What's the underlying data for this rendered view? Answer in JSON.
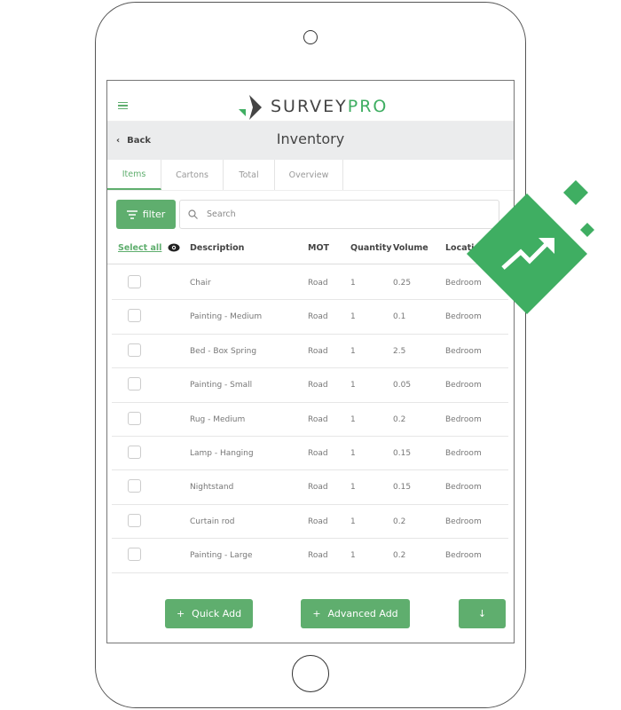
{
  "header": {
    "logo_left": "SURVEY",
    "logo_right": "PRO",
    "back_label": "Back",
    "title": "Inventory"
  },
  "tabs": [
    {
      "label": "Items",
      "active": true
    },
    {
      "label": "Cartons"
    },
    {
      "label": "Total"
    },
    {
      "label": "Overview"
    }
  ],
  "toolbar": {
    "filter_label": "filter",
    "search_placeholder": "Search"
  },
  "table": {
    "select_all": "Select all",
    "columns": [
      "Description",
      "MOT",
      "Quantity",
      "Volume",
      "Location"
    ],
    "rows": [
      [
        "Chair",
        "Road",
        "1",
        "0.25",
        "Bedroom"
      ],
      [
        "Painting - Medium",
        "Road",
        "1",
        "0.1",
        "Bedroom"
      ],
      [
        "Bed - Box Spring",
        "Road",
        "1",
        "2.5",
        "Bedroom"
      ],
      [
        "Painting - Small",
        "Road",
        "1",
        "0.05",
        "Bedroom"
      ],
      [
        "Rug - Medium",
        "Road",
        "1",
        "0.2",
        "Bedroom"
      ],
      [
        "Lamp - Hanging",
        "Road",
        "1",
        "0.15",
        "Bedroom"
      ],
      [
        "Nightstand",
        "Road",
        "1",
        "0.15",
        "Bedroom"
      ],
      [
        "Curtain rod",
        "Road",
        "1",
        "0.2",
        "Bedroom"
      ],
      [
        "Painting - Large",
        "Road",
        "1",
        "0.2",
        "Bedroom"
      ]
    ]
  },
  "actions": {
    "quick_add": "Quick Add",
    "advanced_add": "Advanced Add",
    "plus_icon": "+",
    "down_icon": "↓"
  },
  "colors": {
    "accent": "#5fae6e",
    "badge": "#3fae62"
  }
}
